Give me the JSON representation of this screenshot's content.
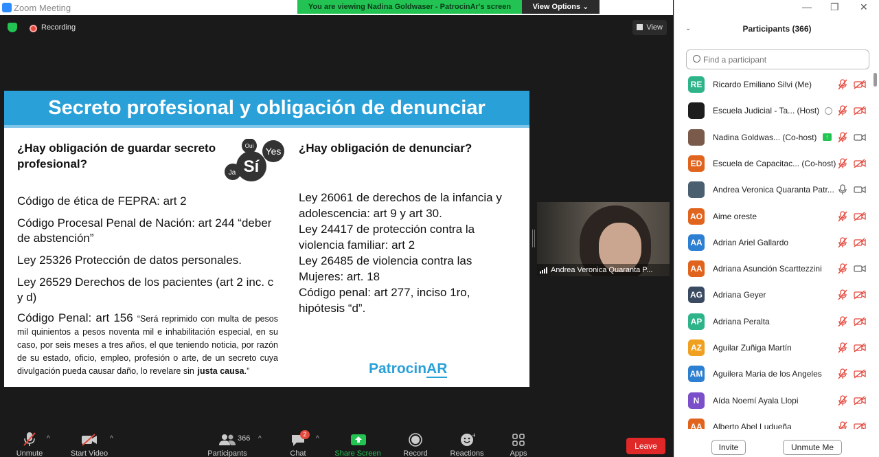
{
  "window": {
    "title": "Zoom Meeting",
    "viewing_message": "You are viewing Nadina Goldwaser - PatrocinAr's screen",
    "view_options": "View Options ⌄",
    "view_button": "View",
    "recording": "Recording"
  },
  "slide": {
    "title": "Secreto profesional y obligación de denunciar",
    "left_question": "¿Hay obligación de guardar secreto profesional?",
    "right_question": "¿Hay obligación de denunciar?",
    "bubbles": [
      "Oui",
      "Sí",
      "Yes",
      "Ja"
    ],
    "left_items": [
      "Código de ética de FEPRA: art 2",
      "Código Procesal Penal de Nación: art 244 “deber de abstención”",
      "Ley 25326 Protección de datos personales.",
      "Ley 26529 Derechos de los pacientes (art 2 inc. c y d)"
    ],
    "penal_prefix": "Código Penal: art 156",
    "penal_quote": "“Será reprimido con multa de pesos mil quinientos a pesos noventa mil e inhabilitación especial, en su caso, por seis meses a tres años, el que teniendo noticia, por razón de su estado, oficio, empleo, profesión o arte, de un secreto cuya divulgación pueda causar daño, lo revelare sin",
    "penal_bold": "justa causa",
    "penal_end": ".”",
    "right_items": [
      "Ley 26061 de derechos de la infancia y adolescencia: art 9 y art 30.",
      "Ley 24417 de protección contra la violencia familiar: art 2",
      "Ley 26485 de violencia contra las Mujeres: art. 18",
      "Código penal: art  277, inciso 1ro, hipótesis “d”."
    ],
    "brand_prefix": "Patrocin",
    "brand_suffix": "AR"
  },
  "webcam": {
    "name": "Andrea Veronica Quaranta P..."
  },
  "toolbar": {
    "unmute": "Unmute",
    "start_video": "Start Video",
    "participants": "Participants",
    "participants_count": "366",
    "chat": "Chat",
    "chat_badge": "2",
    "share_screen": "Share Screen",
    "record": "Record",
    "reactions": "Reactions",
    "apps": "Apps",
    "leave": "Leave"
  },
  "panel": {
    "title": "Participants (366)",
    "search_placeholder": "Find a participant",
    "invite": "Invite",
    "unmute_me": "Unmute Me",
    "participants": [
      {
        "initials": "RE",
        "color": "#2fb48a",
        "name": "Ricardo Emiliano Silvi (Me)",
        "video": "off"
      },
      {
        "initials": "",
        "color": "#1d1d1d",
        "name": "Escuela Judicial - Ta... (Host)",
        "video": "off",
        "recording": true
      },
      {
        "initials": "",
        "color": "#7a5a4a",
        "name": "Nadina Goldwas... (Co-host)",
        "video": "on",
        "sharing": true
      },
      {
        "initials": "ED",
        "color": "#e0641e",
        "name": "Escuela de Capacitac... (Co-host)",
        "video": "off"
      },
      {
        "initials": "",
        "color": "#4a6070",
        "name": "Andrea Veronica Quaranta Patr...",
        "video": "on",
        "mic_on": true
      },
      {
        "initials": "AO",
        "color": "#e0641e",
        "name": " Aime oreste",
        "video": "off"
      },
      {
        "initials": "AA",
        "color": "#2d7fd1",
        "name": "Adrian Ariel Gallardo",
        "video": "off"
      },
      {
        "initials": "AA",
        "color": "#e0641e",
        "name": "Adriana Asunción Scarttezzini",
        "video": "on"
      },
      {
        "initials": "AG",
        "color": "#3a4a60",
        "name": "Adriana Geyer",
        "video": "off"
      },
      {
        "initials": "AP",
        "color": "#2fb48a",
        "name": "Adriana Peralta",
        "video": "off"
      },
      {
        "initials": "AZ",
        "color": "#f0a020",
        "name": "Aguilar Zuñiga Martín",
        "video": "off"
      },
      {
        "initials": "AM",
        "color": "#2d7fd1",
        "name": "Aguilera Maria de los Angeles",
        "video": "off"
      },
      {
        "initials": "N",
        "color": "#7b4fc9",
        "name": "Aída Noemí Ayala Llopi",
        "video": "off"
      },
      {
        "initials": "AA",
        "color": "#e0641e",
        "name": "Alberto Abel Ludueña",
        "video": "off"
      }
    ]
  }
}
